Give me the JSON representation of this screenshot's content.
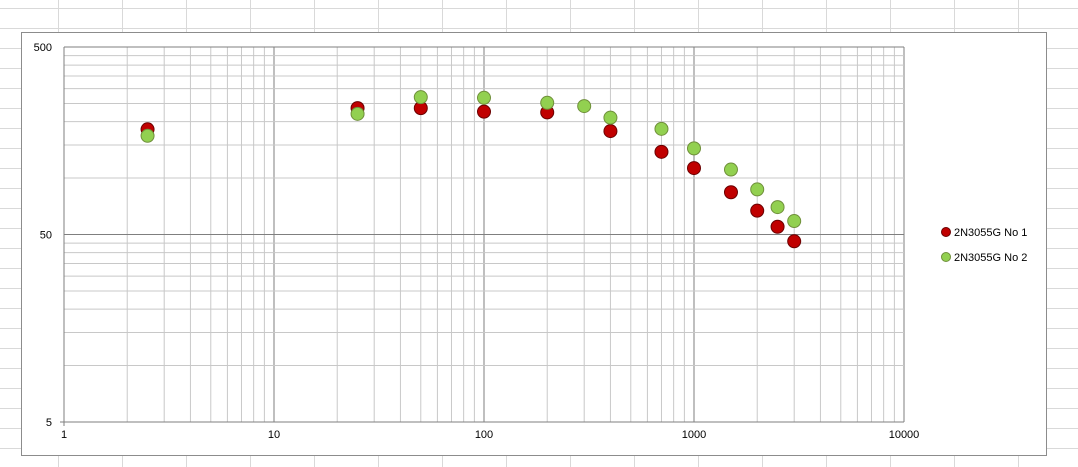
{
  "chart_data": {
    "type": "scatter",
    "x_scale": "log",
    "y_scale": "log",
    "xlim": [
      1,
      10000
    ],
    "ylim": [
      5,
      500
    ],
    "x_tick_labels": [
      "1",
      "10",
      "100",
      "1000",
      "10000"
    ],
    "y_tick_labels": [
      "5",
      "50",
      "500"
    ],
    "grid": "major and minor",
    "legend_position": "right",
    "title": "",
    "xlabel": "",
    "ylabel": "",
    "series": [
      {
        "name": "2N3055G  No 1",
        "color": "#c00000",
        "points": [
          {
            "x": 2.5,
            "y": 182
          },
          {
            "x": 25,
            "y": 236
          },
          {
            "x": 50,
            "y": 236
          },
          {
            "x": 100,
            "y": 226
          },
          {
            "x": 200,
            "y": 224
          },
          {
            "x": 400,
            "y": 178
          },
          {
            "x": 700,
            "y": 138
          },
          {
            "x": 1000,
            "y": 113
          },
          {
            "x": 1500,
            "y": 84
          },
          {
            "x": 2000,
            "y": 67
          },
          {
            "x": 2500,
            "y": 55
          },
          {
            "x": 3000,
            "y": 46
          }
        ]
      },
      {
        "name": "2N3055G  No 2",
        "color": "#92d050",
        "points": [
          {
            "x": 2.5,
            "y": 168
          },
          {
            "x": 25,
            "y": 220
          },
          {
            "x": 50,
            "y": 270
          },
          {
            "x": 100,
            "y": 268
          },
          {
            "x": 200,
            "y": 252
          },
          {
            "x": 300,
            "y": 242
          },
          {
            "x": 400,
            "y": 210
          },
          {
            "x": 700,
            "y": 183
          },
          {
            "x": 1000,
            "y": 144
          },
          {
            "x": 1500,
            "y": 111
          },
          {
            "x": 2000,
            "y": 87
          },
          {
            "x": 2500,
            "y": 70
          },
          {
            "x": 3000,
            "y": 59
          }
        ]
      }
    ]
  }
}
